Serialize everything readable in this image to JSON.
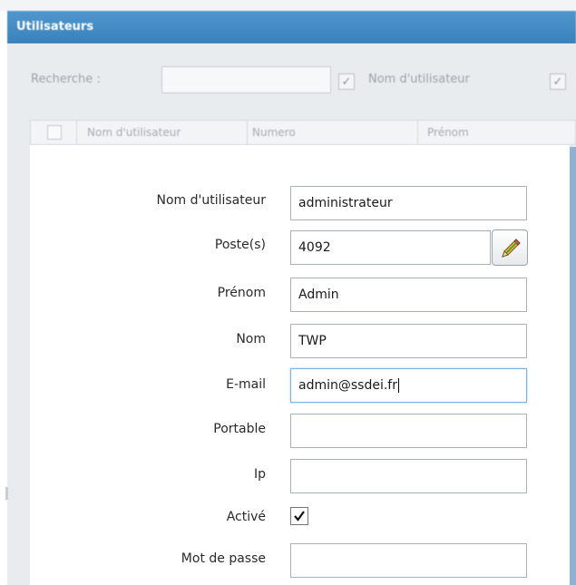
{
  "window": {
    "title": "Utilisateurs"
  },
  "search": {
    "label": "Recherche :",
    "value": "",
    "filter_label": "Nom d'utilisateur"
  },
  "grid": {
    "columns": [
      "Nom d'utilisateur",
      "Numero",
      "Prénom"
    ]
  },
  "form": {
    "username": {
      "label": "Nom d'utilisateur",
      "value": "administrateur"
    },
    "poste": {
      "label": "Poste(s)",
      "value": "4092"
    },
    "prenom": {
      "label": "Prénom",
      "value": "Admin"
    },
    "nom": {
      "label": "Nom",
      "value": "TWP"
    },
    "email": {
      "label": "E-mail",
      "value": "admin@ssdei.fr"
    },
    "portable": {
      "label": "Portable",
      "value": ""
    },
    "ip": {
      "label": "Ip",
      "value": ""
    },
    "active": {
      "label": "Activé",
      "checked": true
    },
    "password": {
      "label": "Mot de passe",
      "value": ""
    }
  },
  "icons": {
    "edit": "pencil-icon",
    "check": "checkmark-icon"
  }
}
